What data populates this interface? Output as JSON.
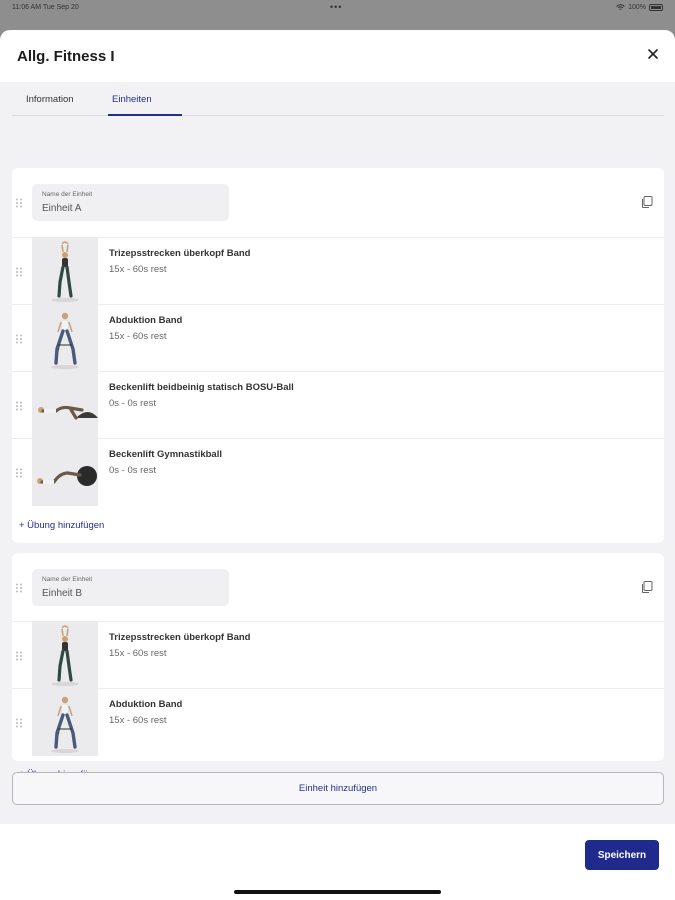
{
  "status_bar": {
    "time": "11:06 AM   Tue Sep 20",
    "dots": "•••",
    "battery": "100%"
  },
  "sheet": {
    "title": "Allg. Fitness I"
  },
  "tabs": [
    {
      "label": "Information",
      "active": false
    },
    {
      "label": "Einheiten",
      "active": true
    }
  ],
  "units": [
    {
      "name_label": "Name der Einheit",
      "name_value": "Einheit A",
      "exercises": [
        {
          "name": "Trizepsstrecken überkopf Band",
          "detail": "15x - 60s rest",
          "image": "standing-overhead-band"
        },
        {
          "name": "Abduktion Band",
          "detail": "15x - 60s rest",
          "image": "standing-band-legs"
        },
        {
          "name": "Beckenlift beidbeinig statisch BOSU-Ball",
          "detail": "0s - 0s rest",
          "image": "bridge-bosu"
        },
        {
          "name": "Beckenlift Gymnastikball",
          "detail": "0s - 0s rest",
          "image": "bridge-ball"
        }
      ],
      "add_exercise_label": "+ Übung hinzufügen"
    },
    {
      "name_label": "Name der Einheit",
      "name_value": "Einheit B",
      "exercises": [
        {
          "name": "Trizepsstrecken überkopf Band",
          "detail": "15x - 60s rest",
          "image": "standing-overhead-band"
        },
        {
          "name": "Abduktion Band",
          "detail": "15x - 60s rest",
          "image": "standing-band-legs"
        }
      ],
      "add_exercise_label": "+ Übung hinzufügen"
    }
  ],
  "add_unit_label": "Einheit hinzufügen",
  "save_label": "Speichern",
  "icons": {
    "close": "close-icon",
    "copy": "copy-icon",
    "drag": "drag-handle-icon",
    "wifi": "wifi-icon",
    "battery": "battery-icon"
  },
  "colors": {
    "accent": "#23308a",
    "button": "#1f2a8c",
    "background": "#f2f2f4"
  }
}
